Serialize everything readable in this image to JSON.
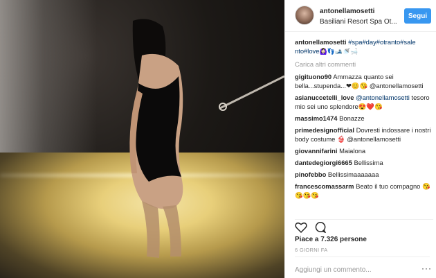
{
  "header": {
    "username": "antonellamosetti",
    "location": "Basiliani Resort Spa Ot...",
    "follow_label": "Segui"
  },
  "caption": {
    "user": "antonellamosetti",
    "text": "#spa#day#otranto#sale nto#love",
    "emoji": "🙆🏻‍♀️👣🎿🚿🛁"
  },
  "load_more": "Carica altri commenti",
  "comments": [
    {
      "user": "gigituono90",
      "tag": "",
      "text": "Ammazza quanto sei bella...stupenda...❤😊😘 @antonellamosetti"
    },
    {
      "user": "asianuccetelli_love",
      "tag": "@antonellamosetti",
      "text": "tesoro mio sei uno splendore😍❤️😘"
    },
    {
      "user": "massimo1474",
      "tag": "",
      "text": "Bonazze"
    },
    {
      "user": "primedesignofficial",
      "tag": "",
      "text": "Dovresti indossare i nostri body costume 👙 @antonellamosetti"
    },
    {
      "user": "giovannifarini",
      "tag": "",
      "text": "Maialona"
    },
    {
      "user": "dantedegiorgi6665",
      "tag": "",
      "text": "Bellissima"
    },
    {
      "user": "pinofebbo",
      "tag": "",
      "text": "Bellissimaaaaaaa"
    },
    {
      "user": "francescomassarm",
      "tag": "",
      "text": "Beato il tuo compagno 😘😘😘😘"
    }
  ],
  "likes": "Piace a 7.326 persone",
  "timestamp": "6 GIORNI FA",
  "comment_input": {
    "placeholder": "Aggiungi un commento..."
  },
  "more_options": "···",
  "colors": {
    "accent": "#3897f0",
    "link": "#003569",
    "muted": "#999999"
  },
  "icons": {
    "like": "heart-icon",
    "comment": "comment-bubble-icon",
    "more": "more-options-icon"
  }
}
